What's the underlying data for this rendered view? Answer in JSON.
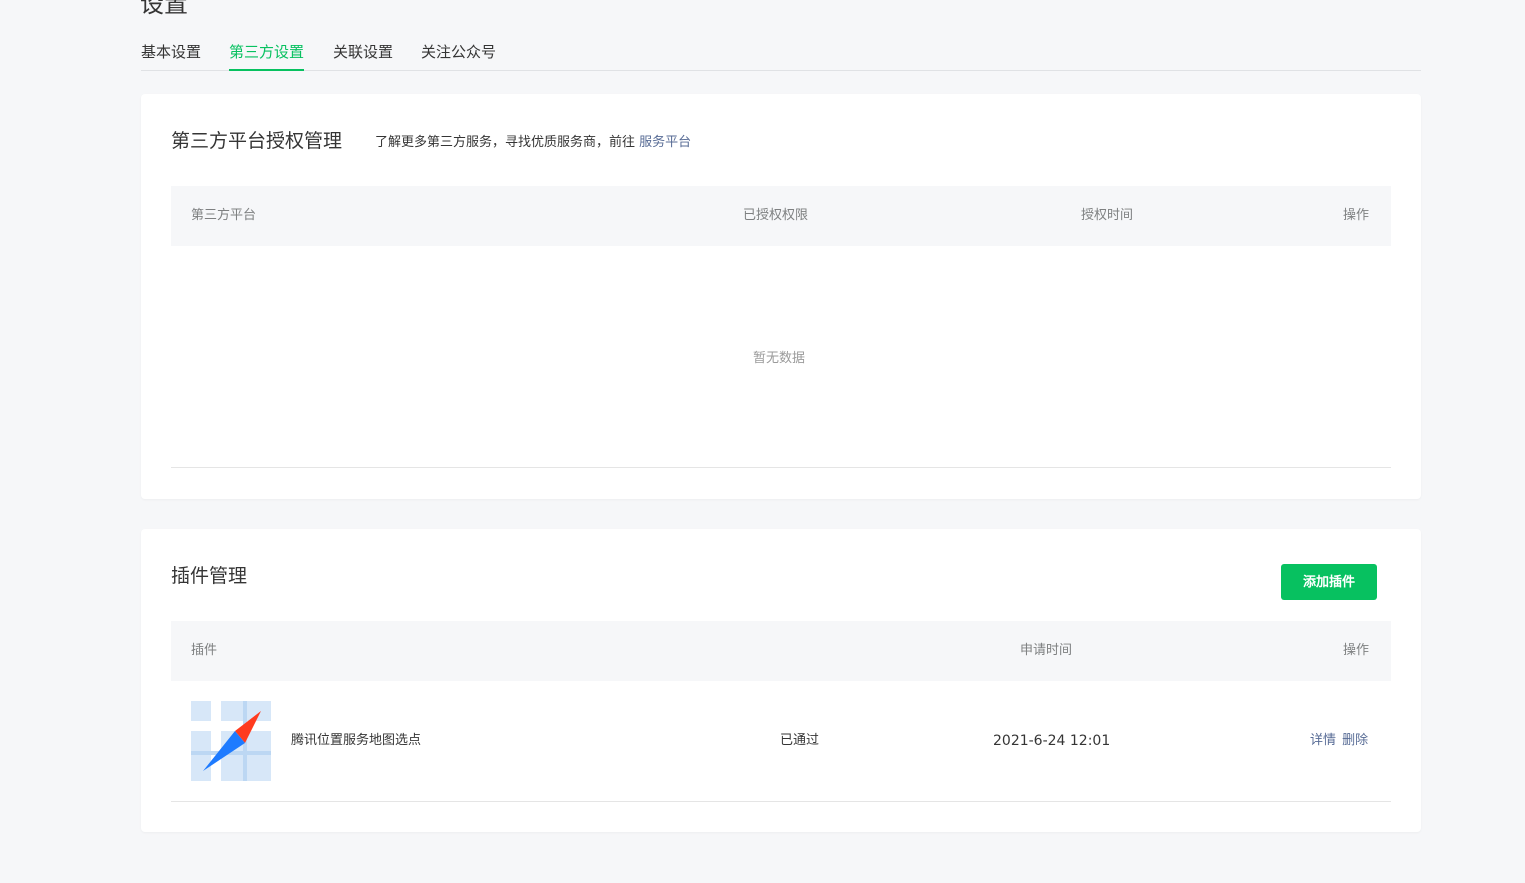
{
  "page": {
    "title": "设置"
  },
  "tabs": [
    {
      "label": "基本设置",
      "active": false
    },
    {
      "label": "第三方设置",
      "active": true
    },
    {
      "label": "关联设置",
      "active": false
    },
    {
      "label": "关注公众号",
      "active": false
    }
  ],
  "third_party": {
    "title": "第三方平台授权管理",
    "desc": "了解更多第三方服务，寻找优质服务商，前往",
    "desc_link": "服务平台",
    "columns": [
      "第三方平台",
      "已授权权限",
      "授权时间",
      "操作"
    ],
    "empty_text": "暂无数据"
  },
  "plugins": {
    "title": "插件管理",
    "add_button": "添加插件",
    "columns": [
      "插件",
      "申请时间",
      "操作"
    ],
    "rows": [
      {
        "name": "腾讯位置服务地图选点",
        "status": "已通过",
        "time": "2021-6-24 12:01",
        "action_detail": "详情",
        "action_delete": "删除",
        "icon": "map-compass-icon"
      }
    ]
  },
  "colors": {
    "accent": "#07c160",
    "link": "#576b95",
    "background": "#f6f7f9"
  }
}
